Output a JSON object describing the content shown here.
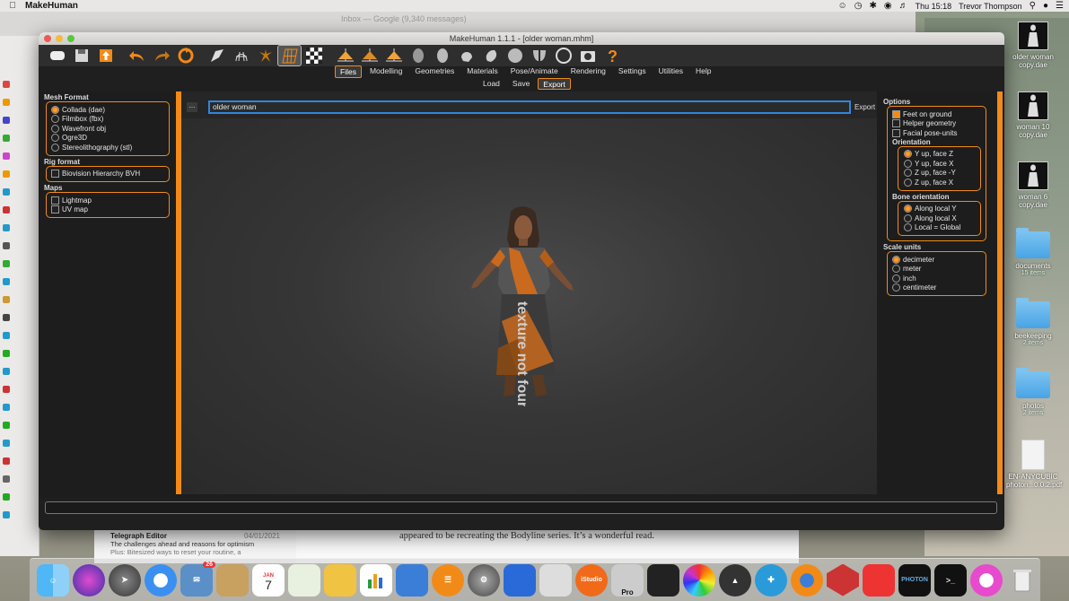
{
  "menubar": {
    "app_name": "MakeHuman",
    "clock": "Thu 15:18",
    "user": "Trevor Thompson"
  },
  "background": {
    "browser_title": "Inbox — Google (9,340 messages)",
    "browser_url": "",
    "mail": {
      "sender": "Telegraph Editor",
      "date": "04/01/2021",
      "subject": "The challenges ahead and reasons for optimism",
      "preview": "Plus: Bitesized ways to reset your routine, a"
    },
    "article_text": "appeared to be recreating the Bodyline series. It’s a wonderful read."
  },
  "window": {
    "title": "MakeHuman 1.1.1 - [older woman.mhm]"
  },
  "tabs": [
    {
      "label": "Files",
      "active": true
    },
    {
      "label": "Modelling"
    },
    {
      "label": "Geometries"
    },
    {
      "label": "Materials"
    },
    {
      "label": "Pose/Animate"
    },
    {
      "label": "Rendering"
    },
    {
      "label": "Settings"
    },
    {
      "label": "Utilities"
    },
    {
      "label": "Help"
    }
  ],
  "subtabs": [
    {
      "label": "Load"
    },
    {
      "label": "Save"
    },
    {
      "label": "Export",
      "active": true
    }
  ],
  "left": {
    "mesh_format": {
      "title": "Mesh Format",
      "options": [
        "Collada (dae)",
        "Filmbox (fbx)",
        "Wavefront obj",
        "Ogre3D",
        "Stereolithography (stl)"
      ],
      "selected": 0
    },
    "rig_format": {
      "title": "Rig format",
      "options": [
        "Biovision Hierarchy BVH"
      ]
    },
    "maps": {
      "title": "Maps",
      "options": [
        "Lightmap",
        "UV map"
      ]
    }
  },
  "viewport": {
    "dots_label": "...",
    "filename": "older woman",
    "export_label": "Export",
    "texture_text": "texture not found"
  },
  "right": {
    "options": {
      "title": "Options",
      "items": [
        {
          "label": "Feet on ground",
          "checked": true
        },
        {
          "label": "Helper geometry",
          "checked": false
        },
        {
          "label": "Facial pose-units",
          "checked": false
        }
      ]
    },
    "orientation": {
      "title": "Orientation",
      "options": [
        "Y up, face Z",
        "Y up, face X",
        "Z up, face -Y",
        "Z up, face X"
      ],
      "selected": 0
    },
    "bone_orientation": {
      "title": "Bone orientation",
      "options": [
        "Along local Y",
        "Along local X",
        "Local = Global"
      ],
      "selected": 0
    },
    "scale_units": {
      "title": "Scale units",
      "options": [
        "decimeter",
        "meter",
        "inch",
        "centimeter"
      ],
      "selected": 0
    }
  },
  "desktop_icons": [
    {
      "label": "older woman copy.dae",
      "kind": "file"
    },
    {
      "label": "woman 10 copy.dae",
      "kind": "file"
    },
    {
      "label": "woman 6 copy.dae",
      "kind": "file"
    },
    {
      "label": "documents",
      "sub": "15 items",
      "kind": "folder"
    },
    {
      "label": "beekeeping",
      "sub": "2 items",
      "kind": "folder"
    },
    {
      "label": "photos",
      "sub": "2 items",
      "kind": "folder"
    },
    {
      "label": "EN-ANYCUBIC photon...0.0.2.pdf",
      "kind": "pdf"
    }
  ],
  "dock": {
    "calendar_day": "7",
    "calendar_month": "JAN",
    "badge": "26",
    "istudio": "iStudio",
    "pro": "Pro",
    "photon": "PHOTON"
  },
  "colors": {
    "accent": "#f28a17",
    "focus": "#2f86e0"
  }
}
